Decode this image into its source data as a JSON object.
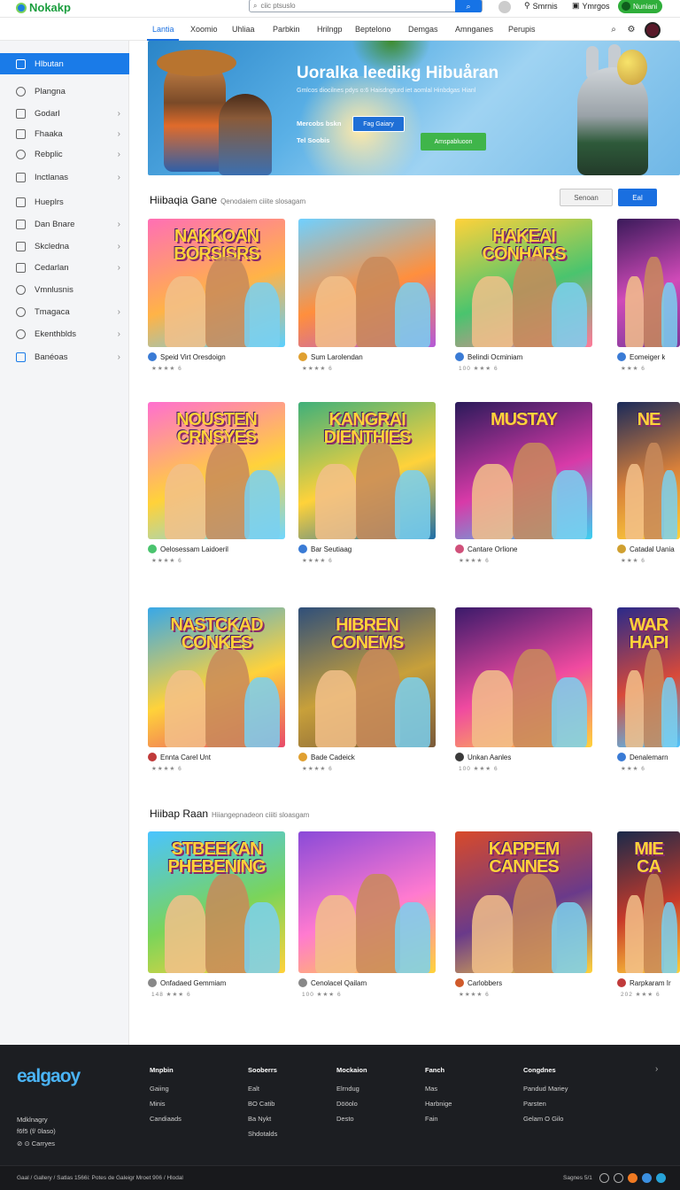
{
  "topbar": {
    "logo": "Nokakp",
    "search_placeholder": "ciic ptsuslo",
    "actions": [
      "Smrnis",
      "Ymrgos"
    ],
    "pill": "Nuniani"
  },
  "nav": {
    "tabs": [
      "Lantia",
      "Xoomio",
      "Uhliaa",
      "Parbkin",
      "Hrilngp",
      "Beptelono",
      "Demgas",
      "Amnganes",
      "Perupis"
    ]
  },
  "sidebar": {
    "items": [
      {
        "label": "Hlbutan",
        "chevron": false
      },
      {
        "label": "Plangna",
        "chevron": false
      },
      {
        "label": "Godarl",
        "chevron": true
      },
      {
        "label": "Fhaaka",
        "chevron": true
      },
      {
        "label": "Rebplic",
        "chevron": true
      },
      {
        "label": "Inctlanas",
        "chevron": true
      },
      {
        "label": "Hueplrs",
        "chevron": false
      },
      {
        "label": "Dan Bnare",
        "chevron": true
      },
      {
        "label": "Skcledna",
        "chevron": true
      },
      {
        "label": "Cedarlan",
        "chevron": true
      },
      {
        "label": "Vmnlusnis",
        "chevron": false
      },
      {
        "label": "Tmagaca",
        "chevron": true
      },
      {
        "label": "Ekenthblds",
        "chevron": true
      },
      {
        "label": "Banéoas",
        "chevron": true
      }
    ]
  },
  "hero": {
    "title": "Uoralka leedikg Hibuåran",
    "subtitle": "Gmlcos diocilnes pdys o:6 Haisdngturd iet aomlal Hinbdgas Hianl",
    "meta1": "Mercobs bskn",
    "meta2": "Tel Soobis",
    "btn_primary": "Fag Gaiary",
    "btn_secondary": "Amspabluoon"
  },
  "section1": {
    "title": "Hiibaqia Gane",
    "subtitle": "Qenodaiem ciiite slosagam",
    "btn_secondary": "Senoan",
    "btn_primary": "Eal"
  },
  "section2": {
    "title": "Hiibap Raan",
    "subtitle": "Hiiangepnadeon ciiiti sloasgam"
  },
  "cards": [
    {
      "title": "NAKKOAN BORSISRS",
      "name": "Speid Virt Oresdoign",
      "rating": "★★★★ 6"
    },
    {
      "title": "",
      "name": "Sum Larolendan",
      "rating": "★★★★ 6"
    },
    {
      "title": "HAKEAI CONHARS",
      "name": "Belindi Ocminiam",
      "rating": "100 ★★★ 6"
    },
    {
      "title": "",
      "name": "Eomeiger k",
      "rating": "★★★ 6"
    },
    {
      "title": "NOUSTEN CRNSYES",
      "name": "Oelosessam Laidoeril",
      "rating": "★★★★ 6"
    },
    {
      "title": "KANGRAI DIENTHIES",
      "name": "Bar Seutiaag",
      "rating": "★★★★ 6"
    },
    {
      "title": "MUSTAY",
      "name": "Cantare Orlione",
      "rating": "★★★★ 6"
    },
    {
      "title": "NE",
      "name": "Catadal Uania",
      "rating": "★★★ 6"
    },
    {
      "title": "NASTCKAD CONKES",
      "name": "Ennta Carel Unt",
      "rating": "★★★★ 6"
    },
    {
      "title": "HIBREN CONEMS",
      "name": "Bade Cadeick",
      "rating": "★★★★ 6"
    },
    {
      "title": "",
      "name": "Unkan Aanles",
      "rating": "100 ★★★ 6"
    },
    {
      "title": "WAR HAPI",
      "name": "Denalemarn",
      "rating": "★★★ 6"
    },
    {
      "title": "STBEEKAN PHEBENING",
      "name": "Onfadaed Gemmiam",
      "rating": "148 ★★★ 6"
    },
    {
      "title": "",
      "name": "Cenolacel Qailam",
      "rating": "100 ★★★ 6"
    },
    {
      "title": "KAPPEM CANNES",
      "name": "Carlobbers",
      "rating": "★★★★ 6"
    },
    {
      "title": "MIE CA",
      "name": "Rarpkaram Ir",
      "rating": "202 ★★★ 6"
    }
  ],
  "footer": {
    "logo": "ealgaoy",
    "cols": [
      {
        "head": "Mnpbin",
        "items": [
          "Gaiing",
          "Minis",
          "Candiaads"
        ]
      },
      {
        "head": "Sooberrs",
        "items": [
          "Ealt",
          "BO Catib",
          "Ba Nykt",
          "Shdotalds"
        ]
      },
      {
        "head": "Mockaion",
        "items": [
          "Elrndug",
          "Dööolo",
          "Desto"
        ]
      },
      {
        "head": "Fanch",
        "items": [
          "Mas",
          "Harbnige",
          "Fain"
        ]
      },
      {
        "head": "Congdnes",
        "items": [
          "Pandud Mariey",
          "Parsten",
          "Gelam O Gilo"
        ]
      }
    ],
    "left": [
      "Mdklnagry",
      "f6f5 (f/ 0laso)",
      "Carryes"
    ],
    "copyright": "Gaal / Gallery / Satlas 1566i: Potes de Galeigr Mroet 906 / Hlodal",
    "lang": "Sagnes 5/1"
  }
}
